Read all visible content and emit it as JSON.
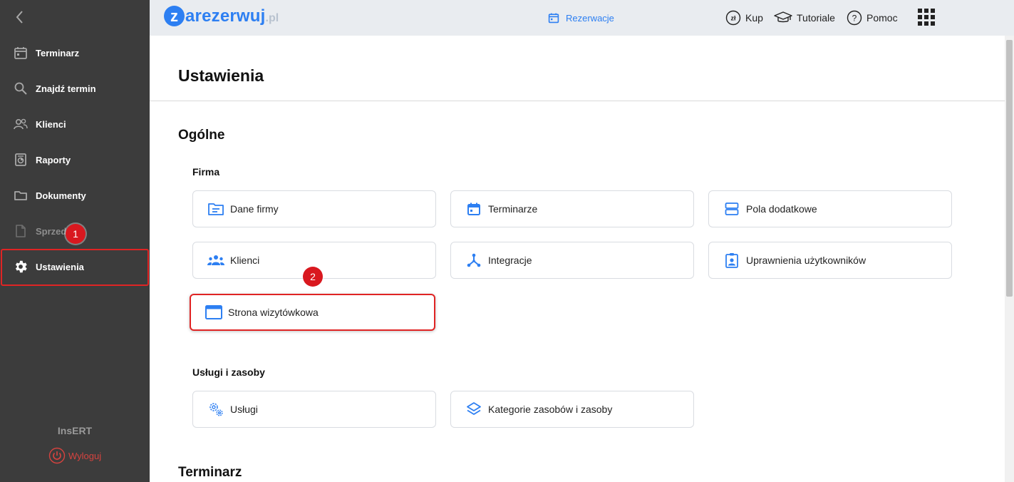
{
  "colors": {
    "accent": "#2d7ff2",
    "sidebar": "#3c3c3c",
    "highlight": "#e02424",
    "logout": "#d6433f"
  },
  "sidebar": {
    "items": [
      {
        "label": "Terminarz",
        "icon": "calendar-icon"
      },
      {
        "label": "Znajdź termin",
        "icon": "search-icon"
      },
      {
        "label": "Klienci",
        "icon": "people-icon"
      },
      {
        "label": "Raporty",
        "icon": "report-icon"
      },
      {
        "label": "Dokumenty",
        "icon": "folder-icon"
      },
      {
        "label": "Sprzedaż",
        "icon": "document-icon"
      },
      {
        "label": "Ustawienia",
        "icon": "gear-icon"
      }
    ],
    "active": "Ustawienia",
    "brand": "InsERT",
    "logout": "Wyloguj"
  },
  "topbar": {
    "logo_letter": "z",
    "logo_word": "arezerwuj",
    "logo_tld": ".pl",
    "reservations": "Rezerwacje",
    "buy": "Kup",
    "tutorials": "Tutoriale",
    "help": "Pomoc"
  },
  "page": {
    "title": "Ustawienia",
    "section_general": "Ogólne",
    "group_company": "Firma",
    "group_services": "Usługi i zasoby",
    "section_scheduler": "Terminarz"
  },
  "company_cards": [
    {
      "label": "Dane firmy",
      "icon": "company-data-icon"
    },
    {
      "label": "Terminarze",
      "icon": "calendar-icon"
    },
    {
      "label": "Pola dodatkowe",
      "icon": "fields-icon"
    },
    {
      "label": "Klienci",
      "icon": "clients-icon"
    },
    {
      "label": "Integracje",
      "icon": "integration-icon"
    },
    {
      "label": "Uprawnienia użytkowników",
      "icon": "user-permissions-icon"
    },
    {
      "label": "Strona wizytówkowa",
      "icon": "browser-window-icon"
    }
  ],
  "services_cards": [
    {
      "label": "Usługi",
      "icon": "services-gears-icon"
    },
    {
      "label": "Kategorie zasobów i zasoby",
      "icon": "layers-icon"
    }
  ],
  "badges": {
    "step1": "1",
    "step2": "2"
  }
}
